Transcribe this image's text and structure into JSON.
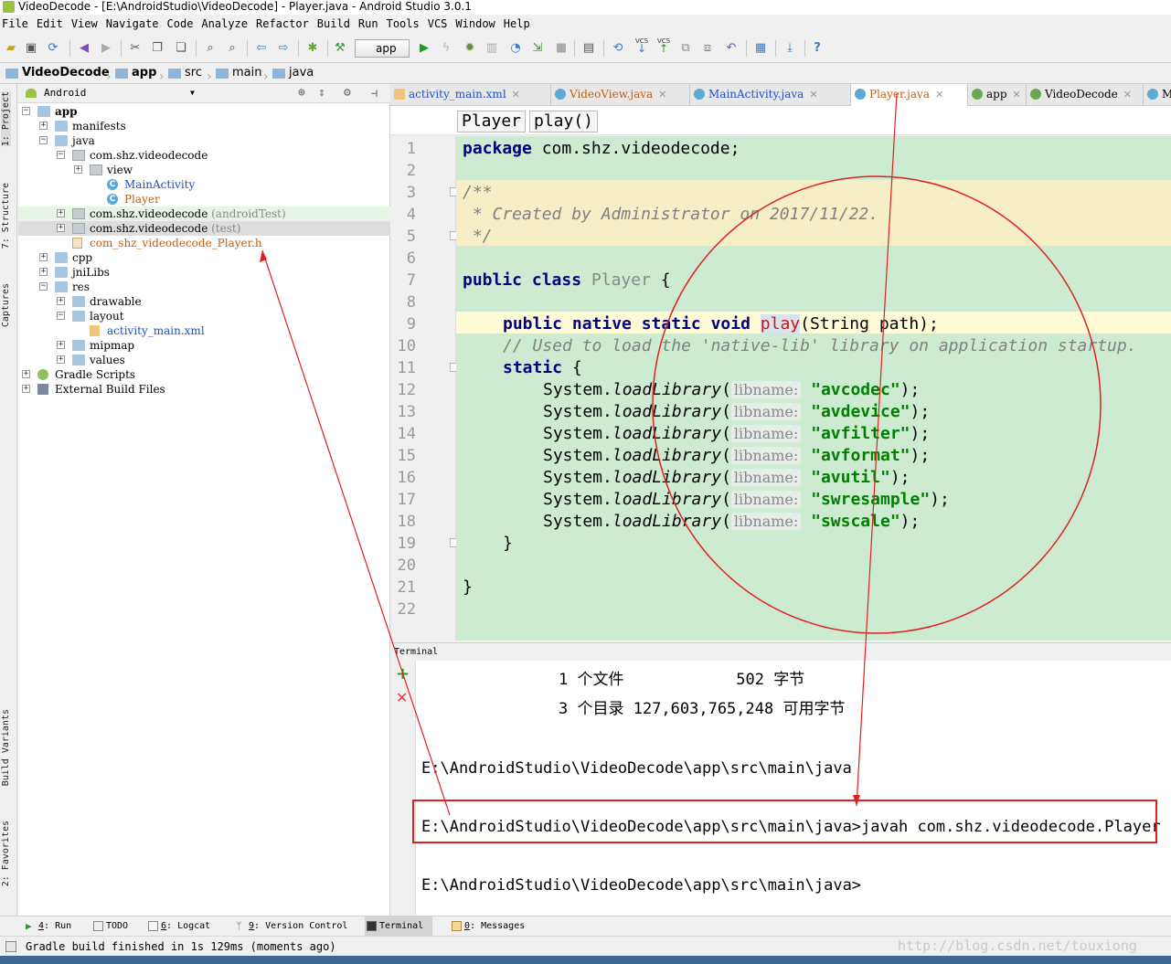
{
  "window": {
    "title": "VideoDecode - [E:\\AndroidStudio\\VideoDecode] - Player.java - Android Studio 3.0.1"
  },
  "menu": [
    "File",
    "Edit",
    "View",
    "Navigate",
    "Code",
    "Analyze",
    "Refactor",
    "Build",
    "Run",
    "Tools",
    "VCS",
    "Window",
    "Help"
  ],
  "toolbar": {
    "run_config": "app",
    "vcs1": "VCS",
    "vcs2": "VCS"
  },
  "breadcrumb": [
    "VideoDecode",
    "app",
    "src",
    "main",
    "java"
  ],
  "left_strip": {
    "project": "1: Project",
    "structure": "7: Structure",
    "captures": "Captures",
    "build_variants": "Build Variants",
    "favorites": "2: Favorites"
  },
  "project_panel": {
    "view_mode": "Android",
    "tree": [
      {
        "label": "app",
        "depth": 0,
        "kind": "module",
        "bold": true
      },
      {
        "label": "manifests",
        "depth": 1,
        "kind": "folder"
      },
      {
        "label": "java",
        "depth": 1,
        "kind": "folder"
      },
      {
        "label": "com.shz.videodecode",
        "depth": 2,
        "kind": "package"
      },
      {
        "label": "view",
        "depth": 3,
        "kind": "package"
      },
      {
        "label": "MainActivity",
        "depth": 4,
        "kind": "class",
        "color": "#1f4fc4"
      },
      {
        "label": "Player",
        "depth": 4,
        "kind": "class",
        "color": "#c06010"
      },
      {
        "label": "com.shz.videodecode",
        "suffix": "(androidTest)",
        "depth": 2,
        "kind": "package",
        "highlight": "#e6f5e6"
      },
      {
        "label": "com.shz.videodecode",
        "suffix": "(test)",
        "depth": 2,
        "kind": "package",
        "highlight": "#dddddd"
      },
      {
        "label": "com_shz_videodecode_Player.h",
        "depth": 2,
        "kind": "hfile",
        "color": "#c06010"
      },
      {
        "label": "cpp",
        "depth": 1,
        "kind": "folder"
      },
      {
        "label": "jniLibs",
        "depth": 1,
        "kind": "folder"
      },
      {
        "label": "res",
        "depth": 1,
        "kind": "folder"
      },
      {
        "label": "drawable",
        "depth": 2,
        "kind": "folder"
      },
      {
        "label": "layout",
        "depth": 2,
        "kind": "folder"
      },
      {
        "label": "activity_main.xml",
        "depth": 3,
        "kind": "xml",
        "color": "#1f4fc4"
      },
      {
        "label": "mipmap",
        "depth": 2,
        "kind": "folder"
      },
      {
        "label": "values",
        "depth": 2,
        "kind": "folder"
      },
      {
        "label": "Gradle Scripts",
        "depth": 0,
        "kind": "gradle"
      },
      {
        "label": "External Build Files",
        "depth": 0,
        "kind": "ext"
      }
    ]
  },
  "editor_tabs": [
    {
      "label": "activity_main.xml",
      "color": "#1f4fc4"
    },
    {
      "label": "VideoView.java",
      "color": "#c06010"
    },
    {
      "label": "MainActivity.java",
      "color": "#1f4fc4"
    },
    {
      "label": "Player.java",
      "color": "#c06010",
      "active": true
    },
    {
      "label": "app",
      "color": "#000000"
    },
    {
      "label": "VideoDecode",
      "color": "#000000"
    },
    {
      "label": "Mai",
      "color": "#000000"
    }
  ],
  "structure_crumbs": [
    "Player",
    "play()"
  ],
  "code": {
    "line_numbers": [
      "1",
      "2",
      "3",
      "4",
      "5",
      "6",
      "7",
      "8",
      "9",
      "10",
      "11",
      "12",
      "13",
      "14",
      "15",
      "16",
      "17",
      "18",
      "19",
      "20",
      "21",
      "22"
    ],
    "package_kw": "package",
    "package_name": " com.shz.videodecode;",
    "c1": "/**",
    "c2": " * Created by Administrator on 2017/11/22.",
    "c3": " */",
    "class_kw": "public class ",
    "class_name": "Player",
    "class_brace": " {",
    "native_kw": "public native static void ",
    "method": "play",
    "params": "(String path);",
    "comment": "// Used to load the 'native-lib' library on application startup.",
    "static_kw": "static",
    "static_brace": " {",
    "sys": "System.",
    "load": "loadLibrary",
    "paren": "(",
    "hint": "libname:",
    "libs": [
      "\"avcodec\"",
      "\"avdevice\"",
      "\"avfilter\"",
      "\"avformat\"",
      "\"avutil\"",
      "\"swresample\"",
      "\"swscale\""
    ],
    "end": ");",
    "close_inner": "}",
    "close_outer": "}"
  },
  "terminal": {
    "title": "Terminal",
    "line1": "1 个文件            502 字节",
    "line2": "3 个目录 127,603,765,248 可用字节",
    "line3": "E:\\AndroidStudio\\VideoDecode\\app\\src\\main\\java",
    "line4": "E:\\AndroidStudio\\VideoDecode\\app\\src\\main\\java>javah com.shz.videodecode.Player",
    "line5": "E:\\AndroidStudio\\VideoDecode\\app\\src\\main\\java>"
  },
  "bottom_tools": [
    {
      "key": "4",
      "label": ": Run"
    },
    {
      "key": "",
      "label": "TODO"
    },
    {
      "key": "6",
      "label": ": Logcat"
    },
    {
      "key": "9",
      "label": ": Version Control"
    },
    {
      "key": "",
      "label": "Terminal",
      "active": true
    },
    {
      "key": "0",
      "label": ": Messages"
    }
  ],
  "status": {
    "message": "Gradle build finished in 1s 129ms (moments ago)"
  },
  "watermark": "http://blog.csdn.net/touxiong",
  "colors": {
    "editor_bg": "#cdebd0",
    "annotation": "#e02020",
    "keyword": "#000080",
    "string": "#008000"
  }
}
